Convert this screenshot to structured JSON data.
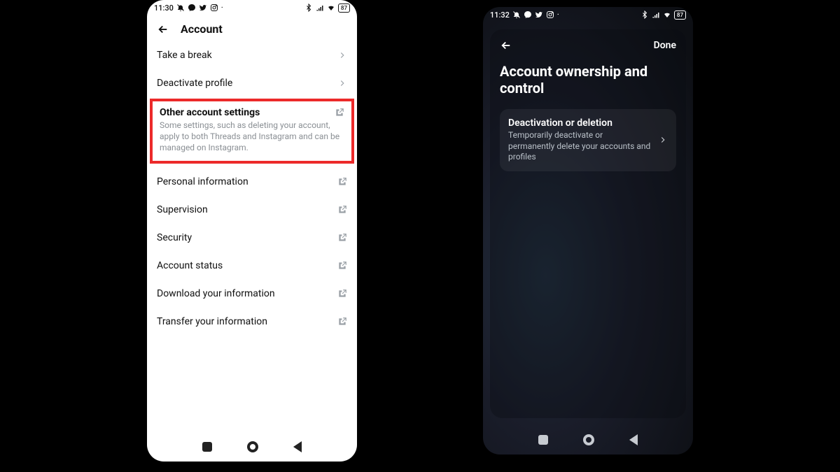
{
  "left": {
    "status": {
      "time": "11:30",
      "battery": "87"
    },
    "header_title": "Account",
    "rows": {
      "take_break": "Take a break",
      "deactivate": "Deactivate profile"
    },
    "section": {
      "title": "Other account settings",
      "desc": "Some settings, such as deleting your account, apply to both Threads and Instagram and can be managed on Instagram."
    },
    "rows2": {
      "personal": "Personal information",
      "supervision": "Supervision",
      "security": "Security",
      "status": "Account status",
      "download": "Download your information",
      "transfer": "Transfer your information"
    }
  },
  "right": {
    "status": {
      "time": "11:32",
      "battery": "87"
    },
    "done": "Done",
    "title": "Account ownership and control",
    "card": {
      "title": "Deactivation or deletion",
      "desc": "Temporarily deactivate or permanently delete your accounts and profiles"
    }
  },
  "highlight_color": "#ec2a2a"
}
